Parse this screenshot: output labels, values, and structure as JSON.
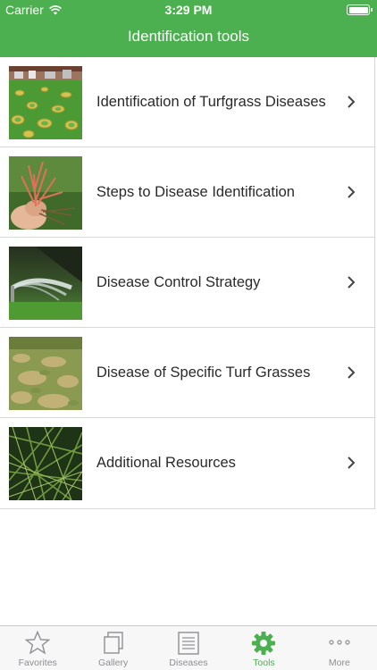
{
  "status_bar": {
    "carrier": "Carrier",
    "time": "3:29 PM"
  },
  "nav": {
    "title": "Identification tools"
  },
  "colors": {
    "accent": "#4caf50",
    "inactive": "#8e8e93"
  },
  "list": {
    "items": [
      {
        "label": "Identification of Turfgrass Diseases",
        "image": "turf-patches-photo"
      },
      {
        "label": "Steps to Disease Identification",
        "image": "pink-thread-in-hand-photo"
      },
      {
        "label": "Disease Control Strategy",
        "image": "sprinkler-irrigation-photo"
      },
      {
        "label": "Disease of Specific Turf Grasses",
        "image": "brown-patch-lawn-photo"
      },
      {
        "label": "Additional Resources",
        "image": "grass-blades-closeup-photo"
      }
    ]
  },
  "tabbar": {
    "active": "Tools",
    "tabs": [
      {
        "label": "Favorites",
        "icon": "star-icon"
      },
      {
        "label": "Gallery",
        "icon": "gallery-icon"
      },
      {
        "label": "Diseases",
        "icon": "document-icon"
      },
      {
        "label": "Tools",
        "icon": "gear-icon"
      },
      {
        "label": "More",
        "icon": "more-icon"
      }
    ]
  }
}
